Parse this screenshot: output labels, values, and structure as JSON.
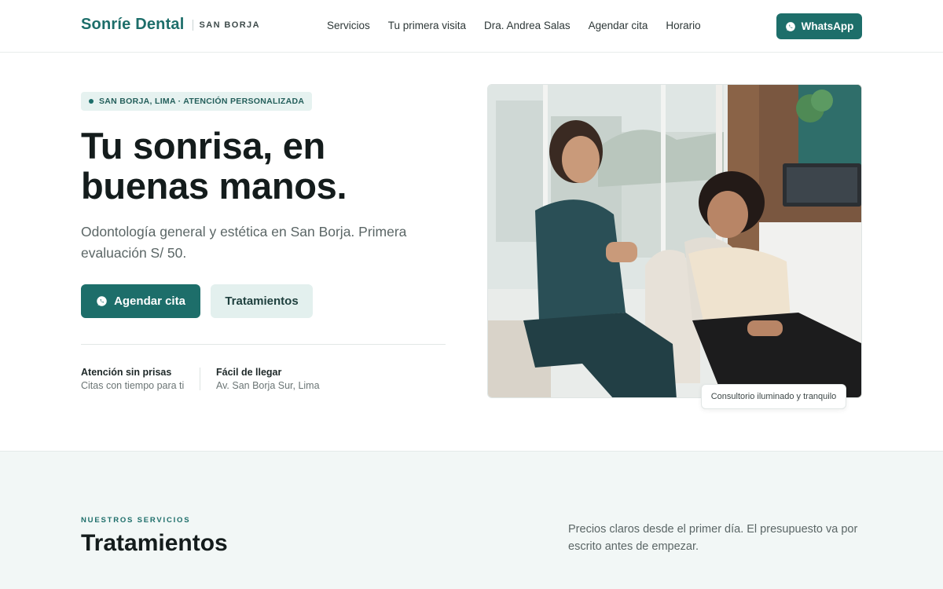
{
  "header": {
    "brand_name": "Sonríe Dental",
    "brand_location": "SAN BORJA",
    "nav": [
      "Servicios",
      "Tu primera visita",
      "Dra. Andrea Salas",
      "Agendar cita",
      "Horario"
    ],
    "whatsapp_label": "WhatsApp"
  },
  "hero": {
    "badge": "SAN BORJA, LIMA · ATENCIÓN PERSONALIZADA",
    "title": "Tu sonrisa, en buenas manos.",
    "subtitle": "Odontología general y estética en San Borja. Primera evaluación S/ 50.",
    "primary_button": "Agendar cita",
    "secondary_button": "Tratamientos",
    "features": [
      {
        "title": "Atención sin prisas",
        "desc": "Citas con tiempo para ti"
      },
      {
        "title": "Fácil de llegar",
        "desc": "Av. San Borja Sur, Lima"
      }
    ],
    "photo_caption": "Consultorio iluminado y tranquilo"
  },
  "services": {
    "eyebrow": "NUESTROS SERVICIOS",
    "title": "Tratamientos",
    "description": "Precios claros desde el primer día. El presupuesto va por escrito antes de empezar."
  },
  "colors": {
    "brand": "#1d6e6a",
    "brand_light": "#e3f0ee",
    "band_bg": "#f2f7f6"
  },
  "icons": {
    "whatsapp": "whatsapp-icon"
  }
}
